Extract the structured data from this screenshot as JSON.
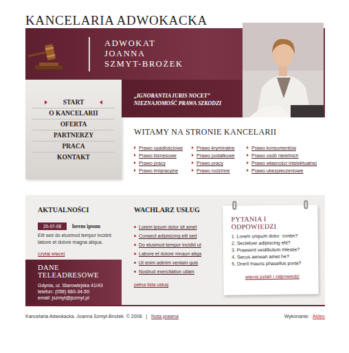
{
  "header": {
    "title": "KANCELARIA ADWOKACKA",
    "name_lines": [
      "ADWOKAT",
      "JOANNA",
      "SZMYT-BROŻEK"
    ],
    "quote": "„IGNORANTIA IURIS NOCET”",
    "quote_translation": "NIEZNAJOMOŚĆ PRAWA SZKODZI"
  },
  "menu": [
    {
      "label": "START",
      "selected": true
    },
    {
      "label": "O KANCELARII",
      "selected": false
    },
    {
      "label": "OFERTA",
      "selected": false
    },
    {
      "label": "PARTNERZY",
      "selected": false
    },
    {
      "label": "PRACA",
      "selected": false
    },
    {
      "label": "KONTAKT",
      "selected": false
    }
  ],
  "welcome": {
    "title": "WITAMY NA STRONIE KANCELARII",
    "links": [
      [
        "Prawo upadłościowe",
        "Prawo biznesowe",
        "Prawo pracy",
        "Prawo imigracyjne"
      ],
      [
        "Prawo kryminalne",
        "Prawo podatkowe",
        "Prawo pracy",
        "Prawo rodzinne"
      ],
      [
        "Prawo konsumentów",
        "Prawo osób nieletnich",
        "Prawo własności intelektualnej",
        "Prawo ubezpieczeniowe"
      ]
    ]
  },
  "news": {
    "title": "AKTUALNOŚCI",
    "date": "20-07-08",
    "headline": "lorens ipsum",
    "text": "Elit sed do eiusmod tempor incidnt labore et dolore magna aliqua.",
    "more": "czytaj więcej"
  },
  "contact": {
    "title": "DANE TELEADRESOWE",
    "lines": [
      "Gdynia, ul. Starowiejska 41/43",
      "telefon: (058) 660-34-50",
      "email: jszmyt@jszmyt.pl"
    ]
  },
  "services": {
    "title": "WACHLARZ USŁUG",
    "items": [
      "Lorem ipsum dolor sit amet",
      "Consect adipisicing elit sed",
      "Do eiusmod tempor incidid ut",
      "Labore et dolore mnaun aliqa",
      "Ut enim admim veniam quis",
      "Nostrud exercitation ullam"
    ],
    "more": "pełna lista usług"
  },
  "faq": {
    "title": "PYTANIA I ODPOWIEDZI",
    "items": [
      "1. Lorem unipum dolor  contin?",
      "2. Sectetuer adipiscing elit?",
      "3. Praesent vestibulum mlestie?",
      "4. Sacus aenean amet he?",
      "5. Drerit mauris phasellus porta?"
    ],
    "more": "więcej pytań i odpowiedzi"
  },
  "footer": {
    "copyright": "Kancelaria Adwokacka. Joanna Szmyt-Brożek  © 2008",
    "separator": "|",
    "legal": "Nota prawna",
    "credit_label": "Wykonanie:",
    "credit": "Aldeo"
  }
}
